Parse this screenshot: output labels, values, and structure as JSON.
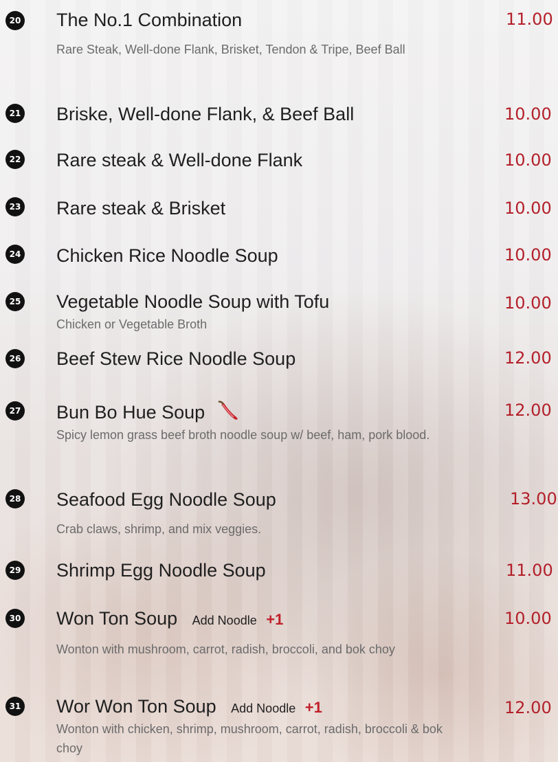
{
  "items": [
    {
      "num": "20",
      "name": "The No.1 Combination",
      "desc": "Rare Steak, Well-done Flank, Brisket, Tendon & Tripe, Beef Ball",
      "price": "11.00"
    },
    {
      "num": "21",
      "name": "Briske, Well-done Flank, & Beef Ball",
      "price": "10.00"
    },
    {
      "num": "22",
      "name": "Rare steak & Well-done Flank",
      "price": "10.00"
    },
    {
      "num": "23",
      "name": "Rare steak & Brisket",
      "price": "10.00"
    },
    {
      "num": "24",
      "name": "Chicken Rice Noodle Soup",
      "price": "10.00"
    },
    {
      "num": "25",
      "name": "Vegetable Noodle Soup with Tofu",
      "desc": "Chicken or Vegetable Broth",
      "price": "10.00"
    },
    {
      "num": "26",
      "name": "Beef Stew Rice Noodle Soup",
      "price": "12.00"
    },
    {
      "num": "27",
      "name": "Bun Bo Hue Soup",
      "desc": "Spicy lemon grass beef broth noodle soup w/ beef, ham, pork blood.",
      "price": "12.00",
      "icon": "chili-pepper-icon"
    },
    {
      "num": "28",
      "name": "Seafood Egg Noodle Soup",
      "desc": "Crab claws, shrimp, and mix veggies.",
      "price": "13.00"
    },
    {
      "num": "29",
      "name": "Shrimp Egg Noodle Soup",
      "price": "11.00"
    },
    {
      "num": "30",
      "name": "Won Ton Soup",
      "addon": "Add Noodle",
      "addon_price": "+1",
      "desc": "Wonton with mushroom, carrot, radish, broccoli, and bok choy",
      "price": "10.00"
    },
    {
      "num": "31",
      "name": "Wor Won Ton Soup",
      "addon": "Add Noodle",
      "addon_price": "+1",
      "desc": "Wonton with chicken, shrimp,  mushroom, carrot, radish, broccoli & bok choy",
      "price": "12.00"
    }
  ],
  "colors": {
    "price": "#b3202a",
    "badge": "#111111",
    "name": "#1f1f1f",
    "desc": "#6b6b6b"
  }
}
